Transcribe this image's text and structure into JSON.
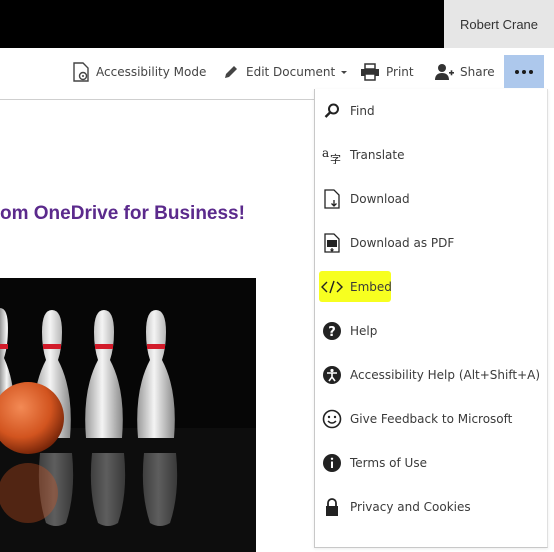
{
  "user": {
    "name": "Robert Crane"
  },
  "toolbar": {
    "accessibility_label": "Accessibility Mode",
    "edit_label": "Edit Document",
    "print_label": "Print",
    "share_label": "Share",
    "more_label": "•••"
  },
  "document": {
    "title_fragment": "om OneDrive for Business!"
  },
  "menu": {
    "items": [
      {
        "label": "Find",
        "icon": "search-icon"
      },
      {
        "label": "Translate",
        "icon": "translate-icon"
      },
      {
        "label": "Download",
        "icon": "download-icon"
      },
      {
        "label": "Download as PDF",
        "icon": "pdf-icon"
      },
      {
        "label": "Embed",
        "icon": "embed-icon"
      },
      {
        "label": "Help",
        "icon": "help-icon"
      },
      {
        "label": "Accessibility Help (Alt+Shift+A)",
        "icon": "accessibility-icon"
      },
      {
        "label": "Give Feedback to Microsoft",
        "icon": "smiley-icon"
      },
      {
        "label": "Terms of Use",
        "icon": "info-icon"
      },
      {
        "label": "Privacy and Cookies",
        "icon": "lock-icon"
      }
    ]
  },
  "colors": {
    "title": "#5b2a8c",
    "more_button": "#adc8ec",
    "highlight": "#f7ff20"
  }
}
